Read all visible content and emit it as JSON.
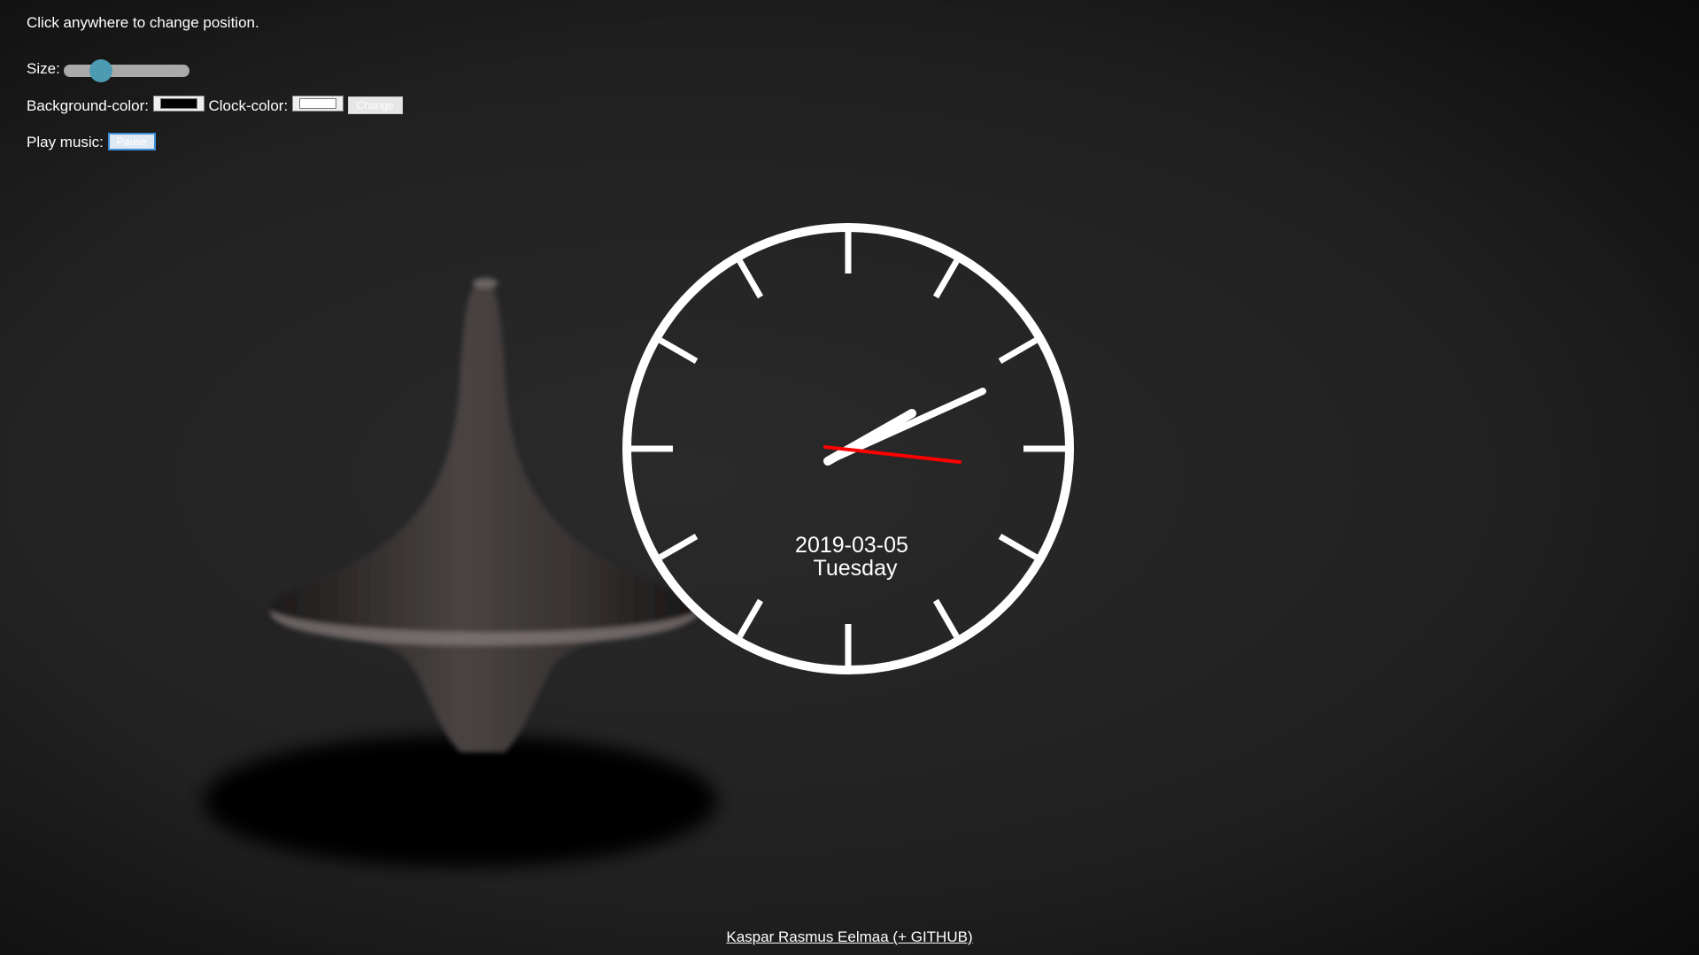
{
  "controls": {
    "hint": "Click anywhere to change position.",
    "size_label": "Size:",
    "size_value": 0.25,
    "background_color_label": "Background-color:",
    "background_color": "#000000",
    "clock_color_label": "Clock-color:",
    "clock_color": "#ffffff",
    "change_button": "Change",
    "play_music_label": "Play music:",
    "pause_button": "Pause"
  },
  "clock": {
    "date": "2019-03-05",
    "weekday": "Tuesday",
    "face_color": "#ffffff",
    "second_hand_color": "#ff0000"
  },
  "footer": {
    "link_text": "Kaspar Rasmus Eelmaa (+ GITHUB)"
  }
}
